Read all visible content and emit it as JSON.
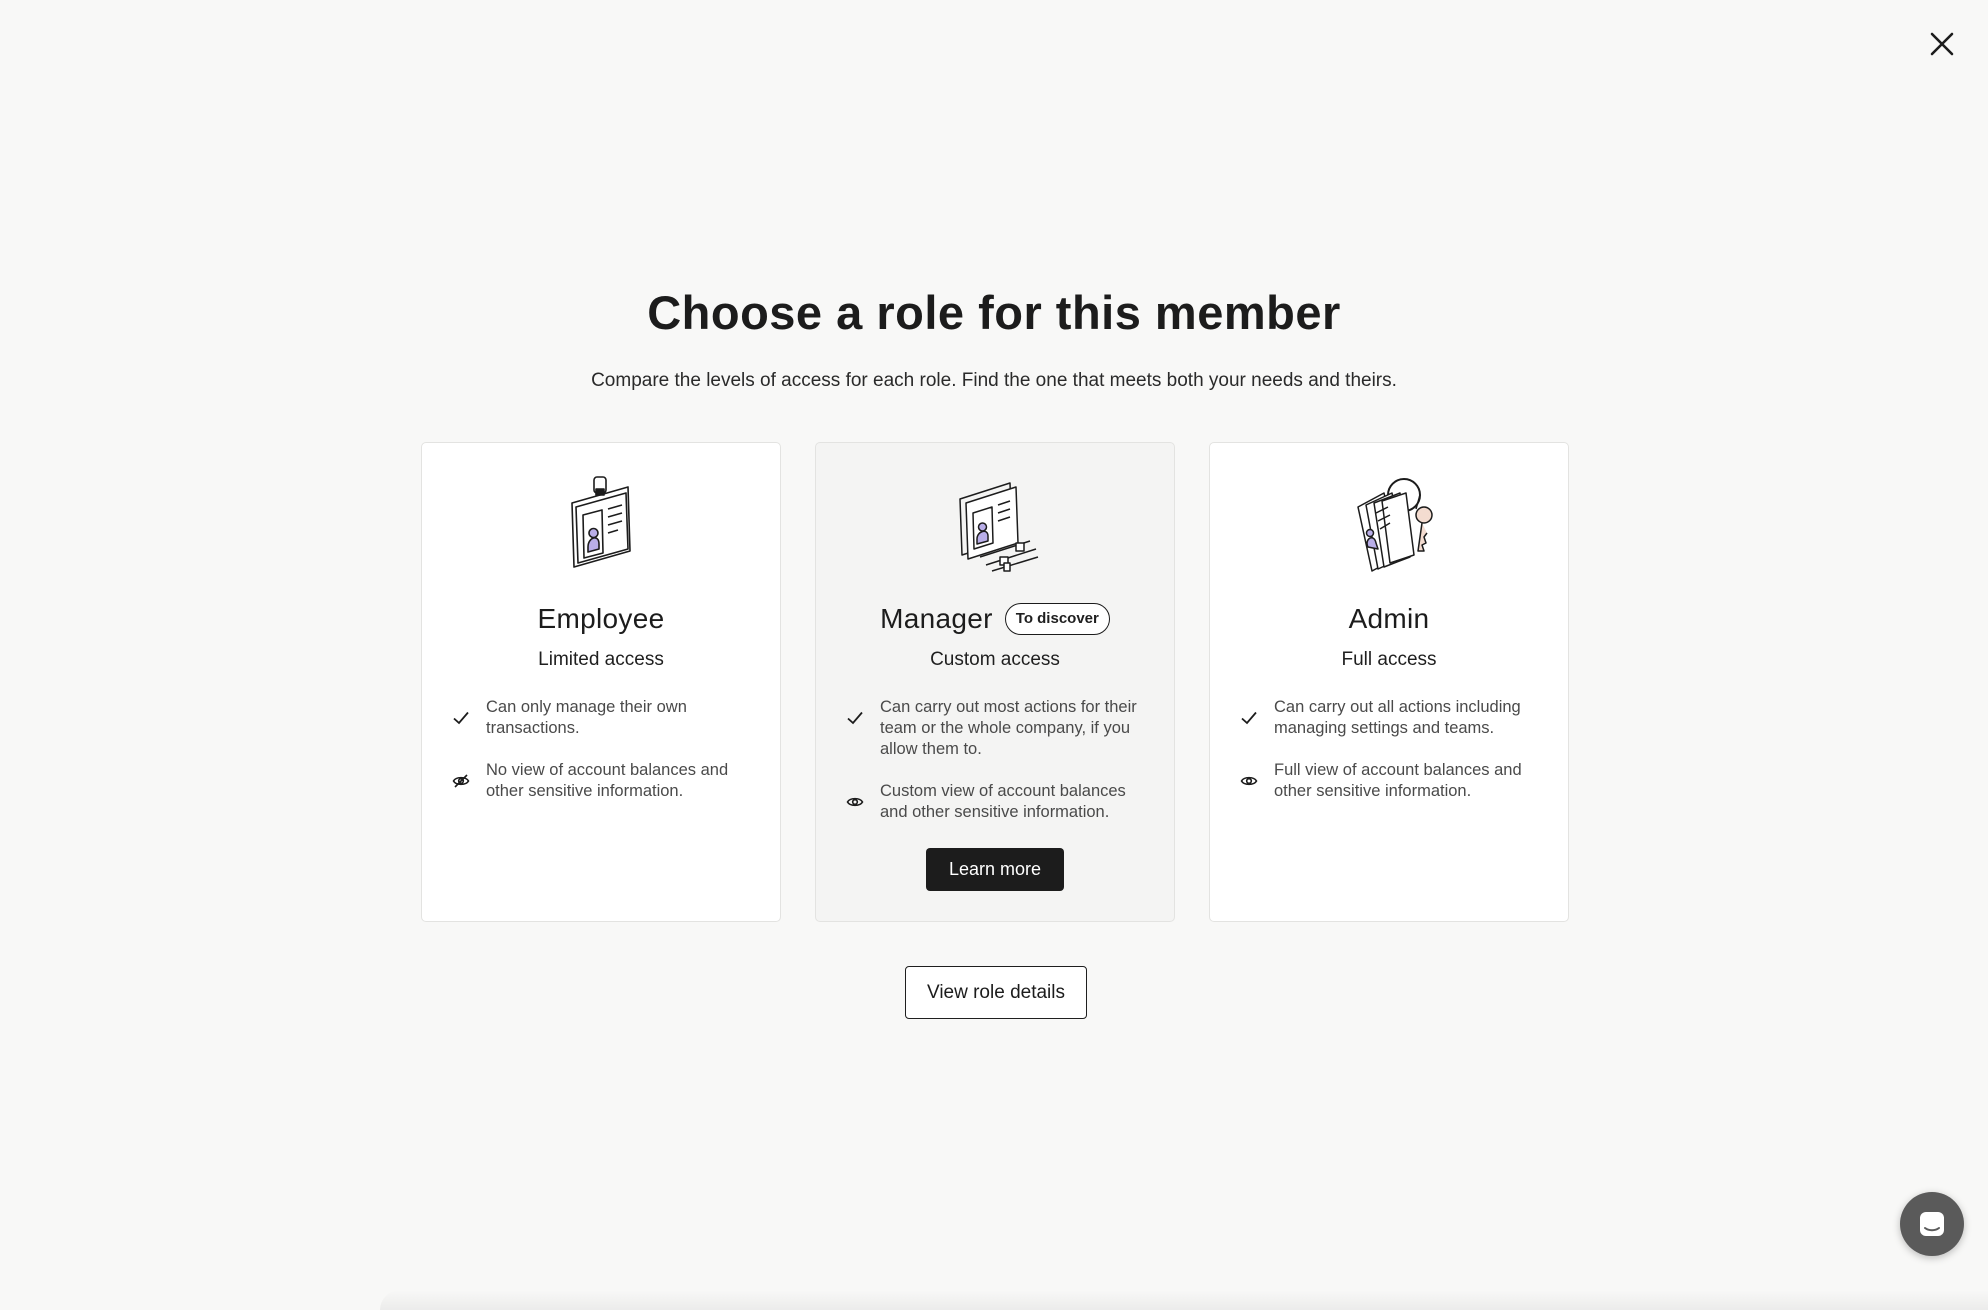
{
  "dialog": {
    "title": "Choose a role for this member",
    "subtitle": "Compare the levels of access for each role. Find the one that meets both your needs and theirs.",
    "close_icon": "close-icon"
  },
  "roles": [
    {
      "name": "Employee",
      "access": "Limited access",
      "illustration": "id-badge-illustration",
      "features": [
        {
          "icon": "check-icon",
          "text": "Can only manage their own transactions."
        },
        {
          "icon": "eye-off-icon",
          "text": "No view of account balances and other sensitive information."
        }
      ]
    },
    {
      "name": "Manager",
      "badge": "To discover",
      "access": "Custom access",
      "illustration": "id-cards-sliders-illustration",
      "features": [
        {
          "icon": "check-icon",
          "text": "Can carry out most actions for their team or the whole company, if you allow them to."
        },
        {
          "icon": "eye-icon",
          "text": "Custom view of account balances and other sensitive information."
        }
      ],
      "button": "Learn more"
    },
    {
      "name": "Admin",
      "access": "Full access",
      "illustration": "keys-cards-illustration",
      "features": [
        {
          "icon": "check-icon",
          "text": "Can carry out all actions including managing settings and teams."
        },
        {
          "icon": "eye-icon",
          "text": "Full view of account balances and other sensitive information."
        }
      ]
    }
  ],
  "footer": {
    "view_details": "View role details"
  },
  "chat": {
    "icon": "chat-icon"
  },
  "colors": {
    "background": "#f8f8f7",
    "primary_button": "#1c1c1c",
    "illustration_accent": "#b9aee8"
  }
}
